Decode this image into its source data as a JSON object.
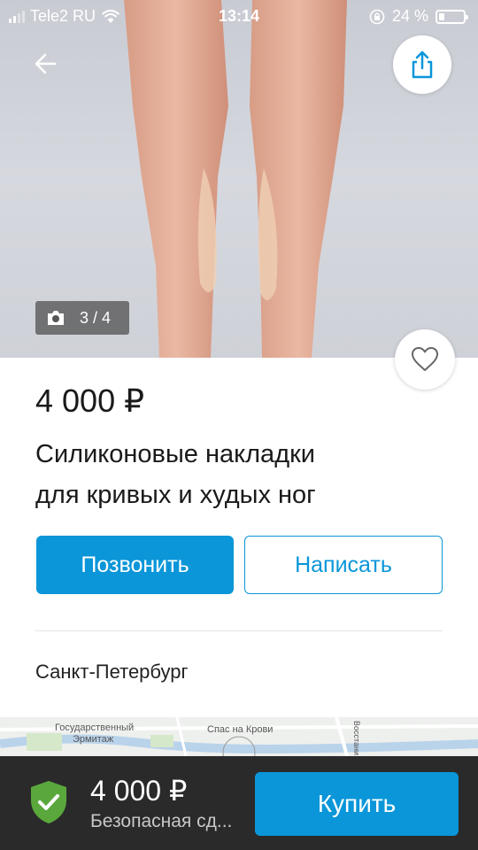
{
  "status_bar": {
    "carrier": "Tele2 RU",
    "time": "13:14",
    "battery_percent": "24 %",
    "battery_level": 0.24
  },
  "photo": {
    "counter": "3 / 4"
  },
  "listing": {
    "price": "4 000 ₽",
    "title_line1": "Силиконовые накладки",
    "title_line2": "для кривых и худых ног",
    "city": "Санкт-Петербург"
  },
  "actions": {
    "call_label": "Позвонить",
    "write_label": "Написать"
  },
  "map": {
    "label_1": "Государственный",
    "label_2": "Эрмитаж",
    "label_3": "Спас на Крови",
    "label_4": "Восстани"
  },
  "bottom_bar": {
    "price": "4 000 ₽",
    "safe_deal": "Безопасная сд...",
    "buy_label": "Купить"
  },
  "colors": {
    "accent": "#0a96d9",
    "bottom_bar_bg": "#2a2a2a",
    "shield_green": "#5aa83c"
  },
  "icons": [
    "back-arrow-icon",
    "share-icon",
    "camera-icon",
    "heart-icon",
    "shield-check-icon",
    "wifi-icon",
    "rotation-lock-icon",
    "battery-icon"
  ]
}
